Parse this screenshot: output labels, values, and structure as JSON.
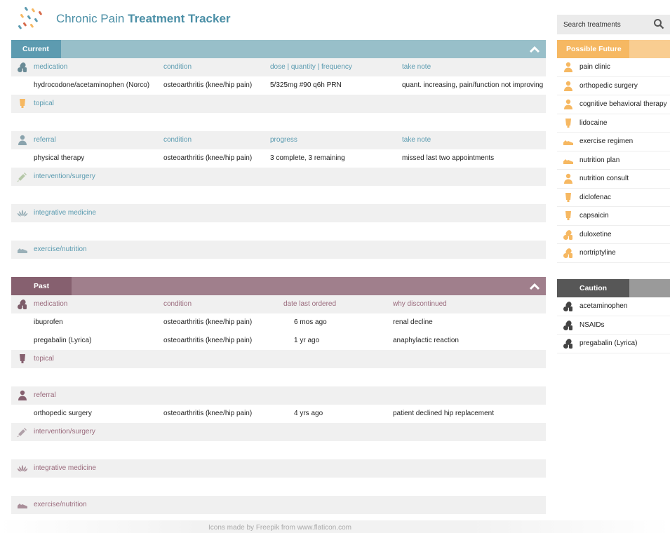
{
  "app": {
    "title_light": "Chronic Pain ",
    "title_bold": "Treatment Tracker"
  },
  "search": {
    "placeholder": "Search treatments"
  },
  "current": {
    "label": "Current",
    "medication": {
      "headers": [
        "medication",
        "condition",
        "dose | quantity | frequency",
        "take note"
      ],
      "rows": [
        [
          "hydrocodone/acetaminophen (Norco)",
          "osteoarthritis (knee/hip pain)",
          "5/325mg  #90  q6h PRN",
          "quant. increasing, pain/function not improving"
        ]
      ]
    },
    "topical": "topical",
    "referral": {
      "headers": [
        "referral",
        "condition",
        "progress",
        "take note"
      ],
      "rows": [
        [
          "physical therapy",
          "osteoarthritis (knee/hip pain)",
          "3 complete, 3 remaining",
          "missed last two appointments"
        ]
      ]
    },
    "intervention": "intervention/surgery",
    "integrative": "integrative medicine",
    "exercise": "exercise/nutrition"
  },
  "past": {
    "label": "Past",
    "medication": {
      "headers": [
        "medication",
        "condition",
        "date last ordered",
        "why discontinued"
      ],
      "rows": [
        [
          "ibuprofen",
          "osteoarthritis (knee/hip pain)",
          "6 mos ago",
          "renal decline"
        ],
        [
          "pregabalin (Lyrica)",
          "osteoarthritis (knee/hip pain)",
          "1 yr ago",
          "anaphylactic reaction"
        ]
      ]
    },
    "topical": "topical",
    "referral": {
      "header": "referral",
      "rows": [
        [
          "orthopedic surgery",
          "osteoarthritis (knee/hip pain)",
          "4 yrs ago",
          "patient declined hip replacement"
        ]
      ]
    },
    "intervention": "intervention/surgery",
    "integrative": "integrative medicine",
    "exercise": "exercise/nutrition"
  },
  "possible_future": {
    "label": "Possible Future",
    "items": [
      {
        "label": "pain clinic",
        "icon": "referral-icon"
      },
      {
        "label": "orthopedic surgery",
        "icon": "referral-icon"
      },
      {
        "label": "cognitive behavioral therapy",
        "icon": "referral-icon"
      },
      {
        "label": "lidocaine",
        "icon": "topical-icon"
      },
      {
        "label": "exercise regimen",
        "icon": "shoe-icon"
      },
      {
        "label": "nutrition plan",
        "icon": "shoe-icon"
      },
      {
        "label": "nutrition consult",
        "icon": "referral-icon"
      },
      {
        "label": "diclofenac",
        "icon": "topical-icon"
      },
      {
        "label": "capsaicin",
        "icon": "topical-icon"
      },
      {
        "label": "duloxetine",
        "icon": "pills-icon"
      },
      {
        "label": "nortriptyline",
        "icon": "pills-icon"
      }
    ]
  },
  "caution": {
    "label": "Caution",
    "items": [
      {
        "label": "acetaminophen",
        "icon": "pills-icon"
      },
      {
        "label": "NSAIDs",
        "icon": "pills-icon"
      },
      {
        "label": "pregabalin (Lyrica)",
        "icon": "pills-icon"
      }
    ]
  },
  "footer": {
    "credit": "Icons made by Freepik from www.flaticon.com"
  },
  "colors": {
    "current": "#98bfc9",
    "current_tab": "#5d9bb0",
    "past": "#a07f8c",
    "past_tab": "#86606f",
    "future": "#f9cd91",
    "future_tab": "#f6b862",
    "caution": "#9a9a9a",
    "caution_tab": "#575757"
  }
}
